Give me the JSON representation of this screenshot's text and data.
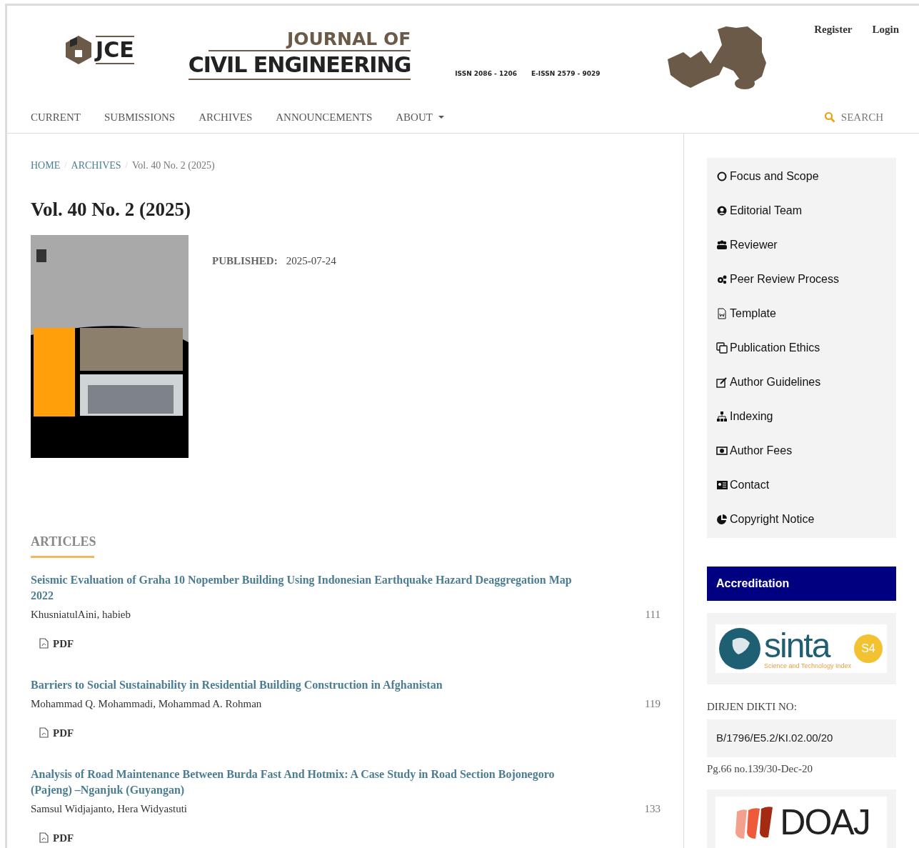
{
  "header": {
    "logo_text": "JCE",
    "banner_line_1": "JOURNAL OF",
    "banner_line_2": "CIVIL ENGINEERING",
    "issn": "ISSN 2086 - 1206",
    "eissn": "E-ISSN 2579 - 9029"
  },
  "user_links": [
    "Register",
    "Login"
  ],
  "nav": [
    {
      "label": "CURRENT",
      "dropdown": false
    },
    {
      "label": "SUBMISSIONS",
      "dropdown": false
    },
    {
      "label": "ARCHIVES",
      "dropdown": false
    },
    {
      "label": "ANNOUNCEMENTS",
      "dropdown": false
    },
    {
      "label": "ABOUT",
      "dropdown": true
    }
  ],
  "search": {
    "label": "SEARCH"
  },
  "breadcrumb_separator": "/",
  "breadcrumb": [
    {
      "label": "HOME",
      "link": true
    },
    {
      "label": "ARCHIVES",
      "link": true
    },
    {
      "label": "Vol. 40 No. 2 (2025)",
      "link": false
    }
  ],
  "issue": {
    "title": "Vol. 40 No. 2 (2025)",
    "published_label": "PUBLISHED:",
    "published_date": "2025-07-24"
  },
  "articles_heading": "ARTICLES",
  "articles": [
    {
      "title": "Seismic Evaluation of Graha 10 Nopember Building Using Indonesian Earthquake Hazard Deaggregation Map 2022",
      "authors": "KhusniatulAini, habieb",
      "pages": "111",
      "galley": "PDF"
    },
    {
      "title": "Barriers to Social Sustainability in Residential Building Construction in Afghanistan",
      "authors": "Mohammad Q. Mohammadi, Mohammad A. Rohman",
      "pages": "119",
      "galley": "PDF"
    },
    {
      "title": "Analysis of Road Maintenance Between Burda Fast And Hotmix: A Case Study in Road Section Bojonegoro (Pajeng) –Nganjuk (Guyangan)",
      "authors": "Samsul Widjajanto, Hera Widyastuti",
      "pages": "133",
      "galley": "PDF"
    }
  ],
  "sidebar": {
    "menu": [
      {
        "label": "Focus and Scope",
        "kind": "circle"
      },
      {
        "label": "Editorial Team",
        "kind": "user"
      },
      {
        "label": "Reviewer",
        "kind": "users"
      },
      {
        "label": "Peer Review Process",
        "kind": "gears"
      },
      {
        "label": "Template",
        "kind": "doc"
      },
      {
        "label": "Publication Ethics",
        "kind": "copy"
      },
      {
        "label": "Author Guidelines",
        "kind": "edit"
      },
      {
        "label": "Indexing",
        "kind": "sitemap"
      },
      {
        "label": "Author Fees",
        "kind": "money"
      },
      {
        "label": "Contact",
        "kind": "card"
      },
      {
        "label": "Copyright Notice",
        "kind": "pie"
      }
    ],
    "accreditation_title": "Accreditation",
    "sinta": {
      "name": "sinta",
      "grade": "S4",
      "tagline": "Science and Technology Index"
    },
    "dirjen_label": "DIRJEN DIKTI NO:",
    "dirjen_number": "B/1796/E5.2/KI.02.00/20",
    "dirjen_note": "Pg.66 no.139/30-Dec-20",
    "doaj": "DOAJ"
  }
}
